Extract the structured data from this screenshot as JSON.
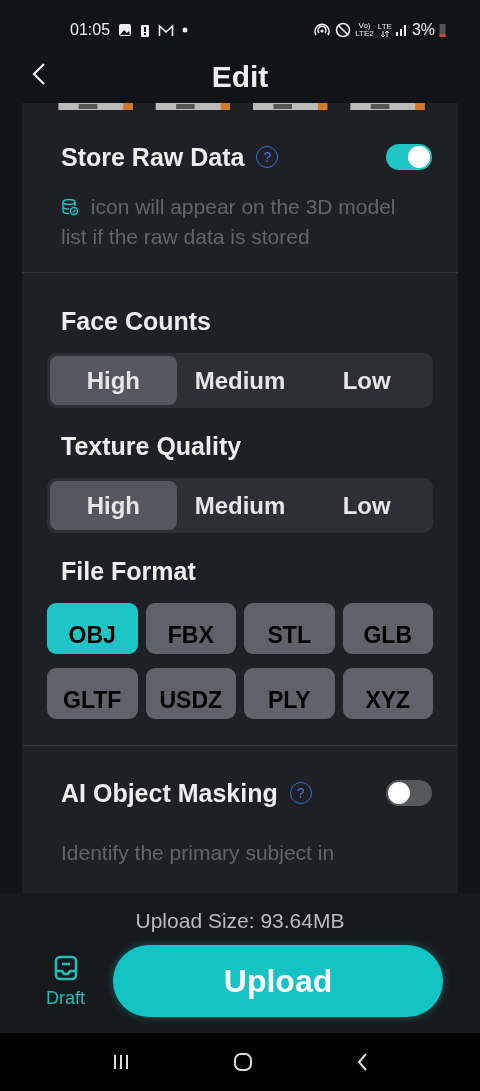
{
  "status_bar": {
    "time": "01:05",
    "battery": "3%",
    "network_top": "Vo)",
    "network_bottom": "LTE2",
    "lte": "LTE"
  },
  "header": {
    "title": "Edit"
  },
  "store_raw": {
    "title": "Store Raw Data",
    "help": "?",
    "on": true,
    "description": "icon will appear on the 3D model list if the raw data is stored"
  },
  "face_counts": {
    "title": "Face Counts",
    "options": [
      {
        "label": "High",
        "selected": true
      },
      {
        "label": "Medium",
        "selected": false
      },
      {
        "label": "Low",
        "selected": false
      }
    ]
  },
  "texture_quality": {
    "title": "Texture Quality",
    "options": [
      {
        "label": "High",
        "selected": true
      },
      {
        "label": "Medium",
        "selected": false
      },
      {
        "label": "Low",
        "selected": false
      }
    ]
  },
  "file_format": {
    "title": "File Format",
    "options": [
      {
        "label": "OBJ",
        "selected": true
      },
      {
        "label": "FBX",
        "selected": false
      },
      {
        "label": "STL",
        "selected": false
      },
      {
        "label": "GLB",
        "selected": false
      },
      {
        "label": "GLTF",
        "selected": false
      },
      {
        "label": "USDZ",
        "selected": false
      },
      {
        "label": "PLY",
        "selected": false
      },
      {
        "label": "XYZ",
        "selected": false
      }
    ]
  },
  "ai_masking": {
    "title": "AI Object Masking",
    "help": "?",
    "on": false,
    "description": "Identify the primary subject in"
  },
  "upload_size": "Upload Size: 93.64MB",
  "draft": "Draft",
  "upload_button": "Upload"
}
